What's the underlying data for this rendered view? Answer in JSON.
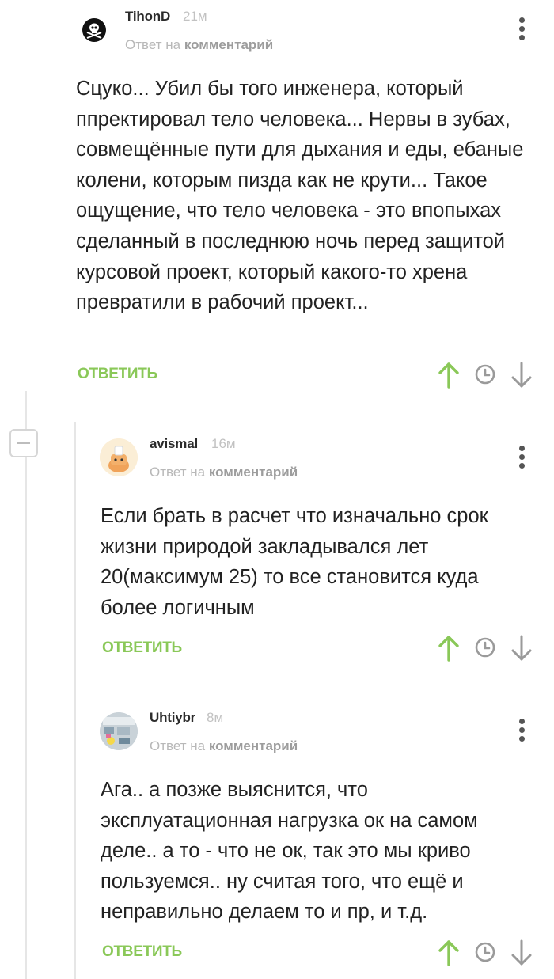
{
  "comments": [
    {
      "username": "TihonD",
      "time": "21м",
      "reply_prefix": "Ответ на",
      "reply_target": "комментарий",
      "text": "Сцуко... Убил бы того инженера, который ппректировал тело человека... Нервы в зубах, совмещённые пути для дыхания и еды, ебаные колени, которым пизда как не крути... Такое ощущение, что тело человека - это впопыхах сделанный в последнюю ночь перед защитой курсовой проект, который какого-то хрена превратили в рабочий проект...",
      "reply_label": "ответить"
    },
    {
      "username": "avismal",
      "time": "16м",
      "reply_prefix": "Ответ на",
      "reply_target": "комментарий",
      "text": "Если брать в расчет что изначально срок жизни природой закладывался лет 20(максимум 25) то все становится куда более логичным",
      "reply_label": "ответить"
    },
    {
      "username": "Uhtiybr",
      "time": "8м",
      "reply_prefix": "Ответ на",
      "reply_target": "комментарий",
      "text": "Ага.. а позже выяснится, что эксплуатационная нагрузка ок на самом деле.. а то - что не ок,  так это мы криво пользуемся.. ну считая того, что ещё и неправильно делаем то и пр, и т.д.",
      "reply_label": "ответить"
    }
  ],
  "colors": {
    "accent_green": "#8ac858",
    "text": "#222222",
    "muted": "#b8b8b8",
    "icon_gray": "#9a9a9a"
  }
}
